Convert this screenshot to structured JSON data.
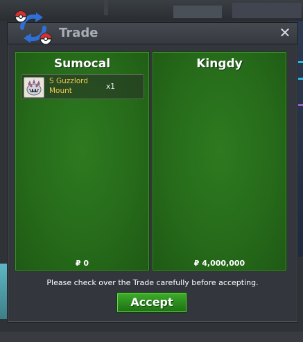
{
  "window": {
    "title": "Trade",
    "close_label": "✕"
  },
  "left_panel": {
    "player_name": "Sumocal",
    "items": [
      {
        "name": "S Guzzlord Mount",
        "quantity": "x1",
        "icon": "guzzlord-mount-icon"
      }
    ],
    "money": "₽ 0"
  },
  "right_panel": {
    "player_name": "Kingdy",
    "items": [],
    "money": "₽ 4,000,000"
  },
  "notice": "Please check over the Trade carefully before accepting.",
  "accept_label": "Accept",
  "colors": {
    "panel_green": "#2e7a20",
    "item_name_gold": "#f2c94c",
    "accept_green": "#3fae2c",
    "title_gray": "#a9aeb5"
  }
}
